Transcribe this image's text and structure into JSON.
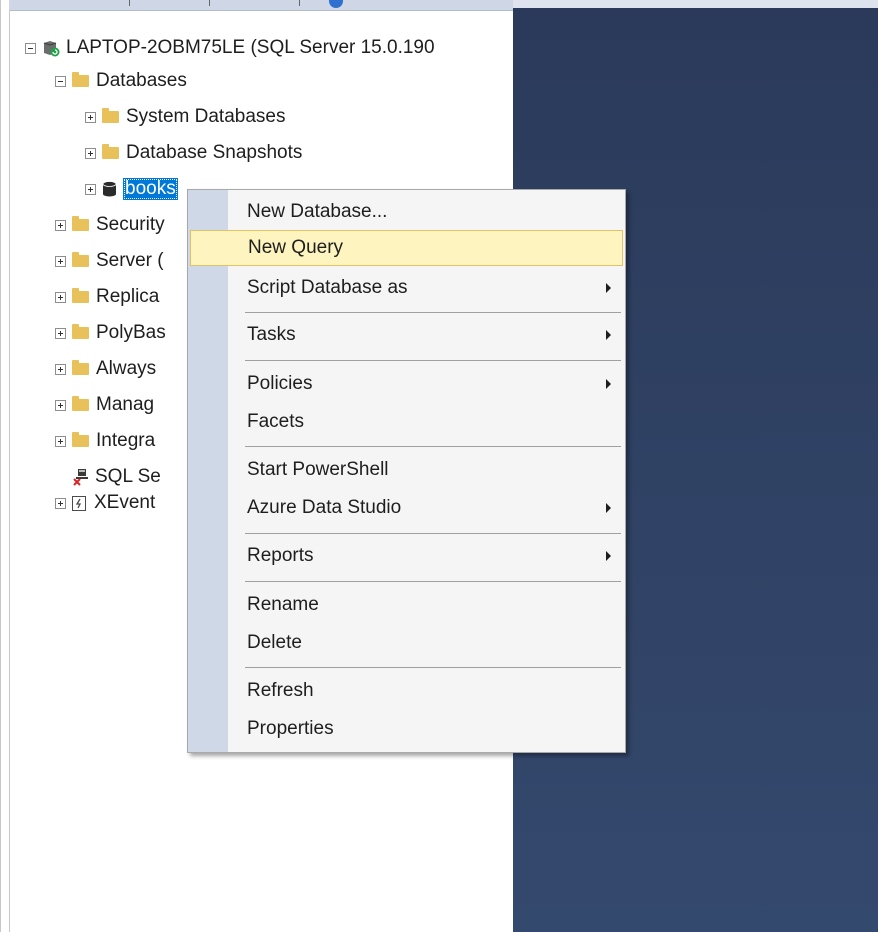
{
  "tree": {
    "server_label": "LAPTOP-2OBM75LE (SQL Server 15.0.190",
    "databases_label": "Databases",
    "system_databases_label": "System Databases",
    "database_snapshots_label": "Database Snapshots",
    "books_label": "books",
    "security_label": "Security",
    "server_objects_label": "Server (",
    "replication_label": "Replica",
    "polybase_label": "PolyBas",
    "always_on_label": "Always",
    "management_label": "Manag",
    "integration_label": "Integra",
    "sql_agent_label": "SQL Se",
    "xevent_label": "XEvent"
  },
  "context_menu": {
    "new_database": "New Database...",
    "new_query": "New Query",
    "script_database_as": "Script Database as",
    "tasks": "Tasks",
    "policies": "Policies",
    "facets": "Facets",
    "start_powershell": "Start PowerShell",
    "azure_data_studio": "Azure Data Studio",
    "reports": "Reports",
    "rename": "Rename",
    "delete": "Delete",
    "refresh": "Refresh",
    "properties": "Properties"
  },
  "icons": {
    "folder": "folder-icon",
    "database": "database-icon",
    "server": "server-icon",
    "agent": "sql-agent-icon",
    "xevent": "xevent-icon",
    "submenu": "submenu-arrow-icon"
  },
  "colors": {
    "selection": "#0078d7",
    "menu_highlight": "#fdf4bf",
    "menu_highlight_border": "#e5c365",
    "menu_gutter": "#cfd8e6",
    "folder": "#e8c15a",
    "doc_background": "#2b3a5a"
  }
}
